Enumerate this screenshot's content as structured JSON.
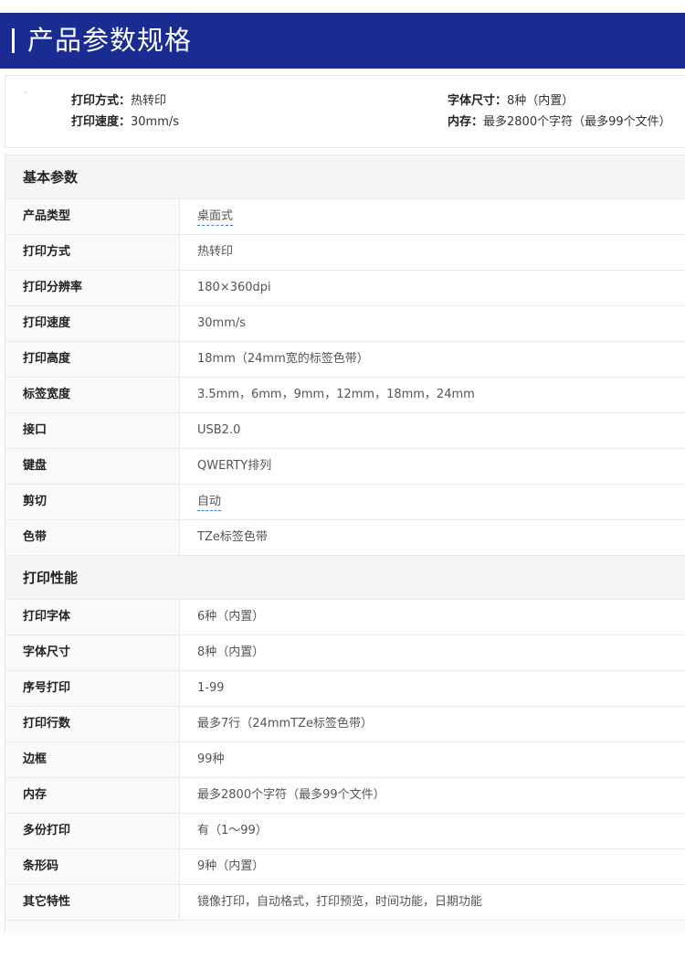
{
  "banner": {
    "title": "产品参数规格"
  },
  "summary": {
    "items": [
      {
        "key": "打印方式：",
        "value": "热转印"
      },
      {
        "key": "打印速度：",
        "value": "30mm/s"
      },
      {
        "key": "字体尺寸：",
        "value": "8种（内置）"
      },
      {
        "key": "内存：",
        "value": "最多2800个字符（最多99个文件）"
      }
    ]
  },
  "sections": [
    {
      "title": "基本参数",
      "rows": [
        {
          "label": "产品类型",
          "value": "桌面式",
          "link": true
        },
        {
          "label": "打印方式",
          "value": "热转印"
        },
        {
          "label": "打印分辨率",
          "value": "180×360dpi"
        },
        {
          "label": "打印速度",
          "value": "30mm/s"
        },
        {
          "label": "打印高度",
          "value": "18mm（24mm宽的标签色带）"
        },
        {
          "label": "标签宽度",
          "value": "3.5mm，6mm，9mm，12mm，18mm，24mm"
        },
        {
          "label": "接口",
          "value": "USB2.0"
        },
        {
          "label": "键盘",
          "value": "QWERTY排列"
        },
        {
          "label": "剪切",
          "value": "自动",
          "link": true
        },
        {
          "label": "色带",
          "value": "TZe标签色带"
        }
      ]
    },
    {
      "title": "打印性能",
      "rows": [
        {
          "label": "打印字体",
          "value": "6种（内置）"
        },
        {
          "label": "字体尺寸",
          "value": "8种（内置）"
        },
        {
          "label": "序号打印",
          "value": "1-99"
        },
        {
          "label": "打印行数",
          "value": "最多7行（24mmTZe标签色带）"
        },
        {
          "label": "边框",
          "value": "99种"
        },
        {
          "label": "内存",
          "value": "最多2800个字符（最多99个文件）"
        },
        {
          "label": "多份打印",
          "value": "有（1～99）"
        },
        {
          "label": "条形码",
          "value": "9种（内置）"
        },
        {
          "label": "其它特性",
          "value": "镜像打印，自动格式，打印预览，时间功能，日期功能"
        }
      ]
    }
  ]
}
